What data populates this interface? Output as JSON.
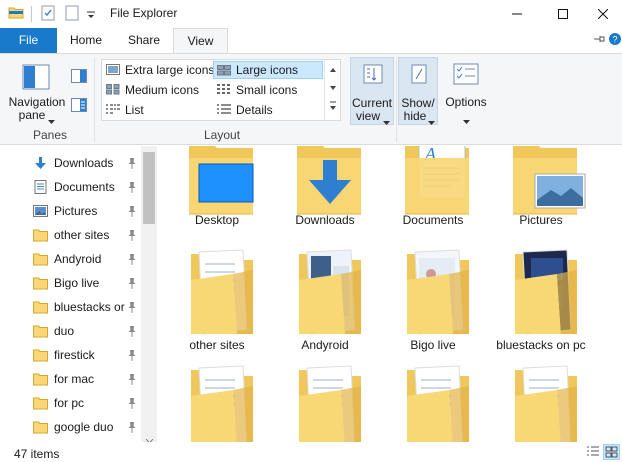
{
  "window": {
    "title": "File Explorer",
    "minimize": "─",
    "maximize": "☐",
    "close": "✕"
  },
  "tabs": [
    {
      "label": "File"
    },
    {
      "label": "Home"
    },
    {
      "label": "Share"
    },
    {
      "label": "View"
    }
  ],
  "ribbon": {
    "panes": {
      "navigation_pane_line1": "Navigation",
      "navigation_pane_line2": "pane",
      "group_label": "Panes"
    },
    "layout": {
      "group_label": "Layout",
      "options": [
        {
          "label": "Extra large icons",
          "selected": false
        },
        {
          "label": "Large icons",
          "selected": true
        },
        {
          "label": "Medium icons",
          "selected": false
        },
        {
          "label": "Small icons",
          "selected": false
        },
        {
          "label": "List",
          "selected": false
        },
        {
          "label": "Details",
          "selected": false
        }
      ]
    },
    "current_view_line1": "Current",
    "current_view_line2": "view",
    "show_hide_line1": "Show/",
    "show_hide_line2": "hide",
    "options": "Options"
  },
  "nav": {
    "items": [
      {
        "label": "Downloads",
        "icon": "download-arrow-icon"
      },
      {
        "label": "Documents",
        "icon": "document-icon"
      },
      {
        "label": "Pictures",
        "icon": "pictures-icon"
      },
      {
        "label": "other sites",
        "icon": "folder-icon"
      },
      {
        "label": "Andyroid",
        "icon": "folder-icon"
      },
      {
        "label": "Bigo live",
        "icon": "folder-icon"
      },
      {
        "label": "bluestacks or",
        "icon": "folder-icon"
      },
      {
        "label": "duo",
        "icon": "folder-icon"
      },
      {
        "label": "firestick",
        "icon": "folder-icon"
      },
      {
        "label": "for mac",
        "icon": "folder-icon"
      },
      {
        "label": "for pc",
        "icon": "folder-icon"
      },
      {
        "label": "google duo",
        "icon": "folder-icon"
      }
    ]
  },
  "content": {
    "tiles": [
      {
        "label": "Desktop",
        "kind": "desktop"
      },
      {
        "label": "Downloads",
        "kind": "downloads"
      },
      {
        "label": "Documents",
        "kind": "documents"
      },
      {
        "label": "Pictures",
        "kind": "pictures"
      },
      {
        "label": "other sites",
        "kind": "folder-docs"
      },
      {
        "label": "Andyroid",
        "kind": "folder-screens"
      },
      {
        "label": "Bigo live",
        "kind": "folder-screens2"
      },
      {
        "label": "bluestacks on pc",
        "kind": "folder-dark"
      },
      {
        "label": "",
        "kind": "folder-docs"
      },
      {
        "label": "",
        "kind": "folder-docs"
      },
      {
        "label": "",
        "kind": "folder-docs"
      },
      {
        "label": "",
        "kind": "folder-docs"
      }
    ]
  },
  "status": {
    "item_count": "47 items"
  },
  "colors": {
    "file_tab": "#1979ca",
    "selection": "#cce8ff",
    "folder": "#f8d775",
    "folder_dark": "#e8b94a"
  }
}
